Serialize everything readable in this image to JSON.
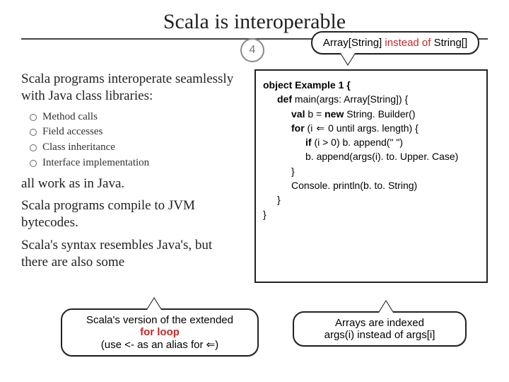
{
  "page_number": "4",
  "title": "Scala is interoperable",
  "left": {
    "p1": "Scala programs interoperate seamlessly with Java class libraries:",
    "items": [
      "Method calls",
      "Field accesses",
      "Class inheritance",
      "Interface implementation"
    ],
    "p2": "all work as in Java.",
    "p3": "Scala programs compile to JVM bytecodes.",
    "p4": "Scala's syntax resembles Java's, but there are also some"
  },
  "code": {
    "l1": "object Example 1 {",
    "l2a": "def",
    "l2b": " main(args: Array[String]) {",
    "l3a": "val",
    "l3b": " b = ",
    "l3c": "new",
    "l3d": " String. Builder()",
    "l4a": "for",
    "l4b": " (i ",
    "l4c": " 0 until args. length) {",
    "l5a": "if",
    "l5b": " (i > 0) b. append(\" \")",
    "l6": "b. append(args(i). to. Upper. Case)",
    "l7": "}",
    "l8": "Console. println(b. to. String)",
    "l9": "}",
    "l10": "}"
  },
  "callouts": {
    "top_a": "Array[String] ",
    "top_b": "instead of",
    "top_c": " String[]",
    "bl1": "Scala's version of the extended",
    "bl2": "for loop",
    "bl3": "(use <- as an alias for ⇐)",
    "br1": "Arrays are indexed",
    "br2": "args(i) instead of args[i]"
  }
}
